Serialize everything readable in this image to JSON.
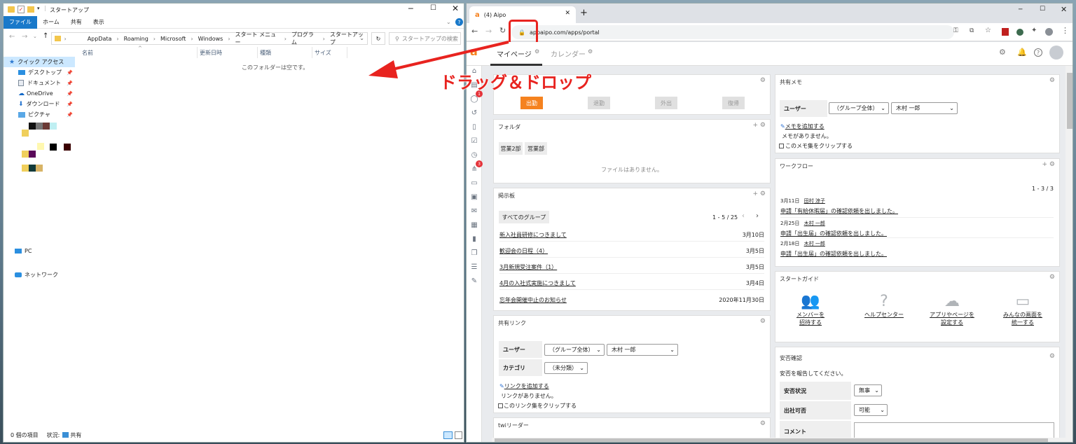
{
  "explorer": {
    "title": "スタートアップ",
    "ribbon_tabs": [
      {
        "label": "ファイル"
      },
      {
        "label": "ホーム"
      },
      {
        "label": "共有"
      },
      {
        "label": "表示"
      }
    ],
    "path": [
      "AppData",
      "Roaming",
      "Microsoft",
      "Windows",
      "スタート メニュー",
      "プログラム",
      "スタートアップ"
    ],
    "search_placeholder": "スタートアップの検索",
    "nav": {
      "quick_access": "クイック アクセス",
      "items": [
        {
          "label": "デスクトップ"
        },
        {
          "label": "ドキュメント"
        },
        {
          "label": "OneDrive"
        },
        {
          "label": "ダウンロード"
        },
        {
          "label": "ピクチャ"
        }
      ],
      "pc": "PC",
      "network": "ネットワーク"
    },
    "columns": {
      "name": "名前",
      "date": "更新日時",
      "type": "種類",
      "size": "サイズ"
    },
    "empty_text": "このフォルダーは空です。",
    "status_items": "0 個の項目",
    "status_state": "状況:",
    "status_shared": "共有"
  },
  "annotation": {
    "label": "ドラッグ＆ドロップ",
    "color": "#e8231f"
  },
  "chrome": {
    "tab_title": "(4) Aipo",
    "url_prefix": "app",
    "url_main": "aipo.com/apps/portal"
  },
  "aipo": {
    "accent": "#f5821f",
    "tabs": {
      "mypage": "マイページ",
      "calendar": "カレンダー"
    },
    "badges": {
      "chat": "1",
      "org": "3"
    },
    "timecard": {
      "buttons": [
        {
          "label": "出勤"
        },
        {
          "label": "退勤"
        },
        {
          "label": "外出"
        },
        {
          "label": "復帰"
        }
      ]
    },
    "folder": {
      "title": "フォルダ",
      "folders": [
        {
          "label": "営業2部"
        },
        {
          "label": "営業部"
        }
      ],
      "empty": "ファイルはありません。"
    },
    "board": {
      "title": "掲示板",
      "group": "すべてのグループ",
      "paging": "1 - 5 / 25",
      "rows": [
        {
          "title": "新入社員研修につきまして",
          "date": "3月10日"
        },
        {
          "title": "歓迎会の日程（4）",
          "date": "3月5日"
        },
        {
          "title": "3月新規受注案件（1）",
          "date": "3月5日"
        },
        {
          "title": "4月の入社式実施につきまして",
          "date": "3月4日"
        },
        {
          "title": "忘年会開催中止のお知らせ",
          "date": "2020年11月30日"
        }
      ]
    },
    "links": {
      "title": "共有リンク",
      "user_label": "ユーザー",
      "group_value": "（グループ全体）",
      "user_value": "木村 一郎",
      "category_label": "カテゴリ",
      "category_value": "（未分類）",
      "add": "リンクを追加する",
      "empty": "リンクがありません。",
      "clip": "このリンク集をクリップする"
    },
    "twi": {
      "title": "twiリーダー"
    },
    "memo": {
      "title": "共有メモ",
      "user_label": "ユーザー",
      "group_value": "（グループ全体）",
      "user_value": "木村 一郎",
      "add": "メモを追加する",
      "empty": "メモがありません。",
      "clip": "このメモ集をクリップする"
    },
    "workflow": {
      "title": "ワークフロー",
      "paging": "1 - 3 / 3",
      "items": [
        {
          "date": "3月11日",
          "user": "田村 涼子",
          "text": "申請「有給休暇届」の確認依頼を出しました。"
        },
        {
          "date": "2月25日",
          "user": "木村 一郎",
          "text": "申請「出生届」の確認依頼を出しました。"
        },
        {
          "date": "2月18日",
          "user": "木村 一郎",
          "text": "申請「出生届」の確認依頼を出しました。"
        }
      ]
    },
    "guide": {
      "title": "スタートガイド",
      "items": [
        {
          "line1": "メンバーを",
          "line2": "招待する"
        },
        {
          "line1": "ヘルプセンター",
          "line2": ""
        },
        {
          "line1": "アプリやページを",
          "line2": "設定する"
        },
        {
          "line1": "みんなの画面を",
          "line2": "統一する"
        }
      ]
    },
    "safety": {
      "title": "安否確認",
      "prompt": "安否を報告してください。",
      "status_label": "安否状況",
      "status_value": "無事",
      "attend_label": "出社可否",
      "attend_value": "可能",
      "comment_label": "コメント"
    }
  }
}
